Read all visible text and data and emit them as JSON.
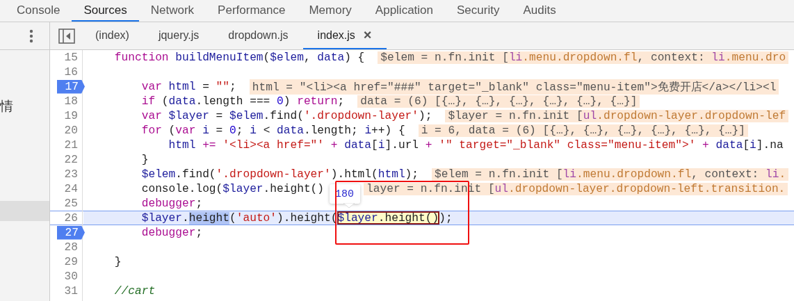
{
  "panel_tabs": [
    {
      "label": "Console",
      "selected": false
    },
    {
      "label": "Sources",
      "selected": true
    },
    {
      "label": "Network",
      "selected": false
    },
    {
      "label": "Performance",
      "selected": false
    },
    {
      "label": "Memory",
      "selected": false
    },
    {
      "label": "Application",
      "selected": false
    },
    {
      "label": "Security",
      "selected": false
    },
    {
      "label": "Audits",
      "selected": false
    }
  ],
  "navigator": {
    "text": "情"
  },
  "file_tabs": [
    {
      "label": "(index)",
      "selected": false
    },
    {
      "label": "jquery.js",
      "selected": false
    },
    {
      "label": "dropdown.js",
      "selected": false
    },
    {
      "label": "index.js",
      "selected": true,
      "close": "×"
    }
  ],
  "lines": [
    {
      "number": "15",
      "breakpoint": false,
      "current": false,
      "tokens": [
        {
          "kind": "keyword",
          "text": "    function"
        },
        {
          "kind": "name",
          "text": " buildMenuItem"
        },
        {
          "kind": "plain",
          "text": "("
        },
        {
          "kind": "name",
          "text": "$elem"
        },
        {
          "kind": "plain",
          "text": ", "
        },
        {
          "kind": "name",
          "text": "data"
        },
        {
          "kind": "plain",
          "text": ") {"
        }
      ],
      "annotation": [
        {
          "kind": "value",
          "text": "$elem = n.fn.init ["
        },
        {
          "kind": "tag",
          "text": "li"
        },
        {
          "kind": "class",
          "text": ".menu.dropdown.fl"
        },
        {
          "kind": "value",
          "text": ", context: "
        },
        {
          "kind": "tag",
          "text": "li"
        },
        {
          "kind": "class",
          "text": ".menu.dro"
        }
      ]
    },
    {
      "number": "16",
      "breakpoint": false,
      "current": false
    },
    {
      "number": "17",
      "breakpoint": true,
      "current": false,
      "tokens": [
        {
          "kind": "keyword",
          "text": "        var"
        },
        {
          "kind": "name",
          "text": " html"
        },
        {
          "kind": "plain",
          "text": " = "
        },
        {
          "kind": "string",
          "text": "\"\""
        },
        {
          "kind": "plain",
          "text": ";"
        }
      ],
      "annotation": [
        {
          "kind": "value",
          "text": "html = \"<li><a href=\"###\" target=\"_blank\" class=\"menu-item\">免费开店</a></li><l"
        }
      ]
    },
    {
      "number": "18",
      "breakpoint": false,
      "current": false,
      "tokens": [
        {
          "kind": "keyword",
          "text": "        if"
        },
        {
          "kind": "plain",
          "text": " ("
        },
        {
          "kind": "name",
          "text": "data"
        },
        {
          "kind": "plain",
          "text": ".length === "
        },
        {
          "kind": "number",
          "text": "0"
        },
        {
          "kind": "plain",
          "text": ") "
        },
        {
          "kind": "keyword",
          "text": "return"
        },
        {
          "kind": "plain",
          "text": ";"
        }
      ],
      "annotation": [
        {
          "kind": "value",
          "text": "data = (6) [{…}, {…}, {…}, {…}, {…}, {…}]"
        }
      ]
    },
    {
      "number": "19",
      "breakpoint": false,
      "current": false,
      "tokens": [
        {
          "kind": "keyword",
          "text": "        var"
        },
        {
          "kind": "name",
          "text": " $layer"
        },
        {
          "kind": "plain",
          "text": " = "
        },
        {
          "kind": "name",
          "text": "$elem"
        },
        {
          "kind": "plain",
          "text": ".find("
        },
        {
          "kind": "string",
          "text": "'.dropdown-layer'"
        },
        {
          "kind": "plain",
          "text": ");"
        }
      ],
      "annotation": [
        {
          "kind": "value",
          "text": "$layer = n.fn.init ["
        },
        {
          "kind": "tag",
          "text": "ul"
        },
        {
          "kind": "class",
          "text": ".dropdown-layer.dropdown-lef"
        }
      ]
    },
    {
      "number": "20",
      "breakpoint": false,
      "current": false,
      "tokens": [
        {
          "kind": "keyword",
          "text": "        for"
        },
        {
          "kind": "plain",
          "text": " ("
        },
        {
          "kind": "keyword",
          "text": "var"
        },
        {
          "kind": "name",
          "text": " i"
        },
        {
          "kind": "plain",
          "text": " = "
        },
        {
          "kind": "number",
          "text": "0"
        },
        {
          "kind": "plain",
          "text": "; "
        },
        {
          "kind": "name",
          "text": "i"
        },
        {
          "kind": "plain",
          "text": " < "
        },
        {
          "kind": "name",
          "text": "data"
        },
        {
          "kind": "plain",
          "text": ".length; "
        },
        {
          "kind": "name",
          "text": "i"
        },
        {
          "kind": "plain",
          "text": "++) {"
        }
      ],
      "annotation": [
        {
          "kind": "value",
          "text": "i = 6, data = (6) [{…}, {…}, {…}, {…}, {…}, {…}]"
        }
      ]
    },
    {
      "number": "21",
      "breakpoint": false,
      "current": false,
      "tokens": [
        {
          "kind": "name",
          "text": "            html"
        },
        {
          "kind": "operator",
          "text": " +="
        },
        {
          "kind": "string",
          "text": " '<li><a href=\"'"
        },
        {
          "kind": "operator",
          "text": " +"
        },
        {
          "kind": "name",
          "text": " data"
        },
        {
          "kind": "plain",
          "text": "["
        },
        {
          "kind": "name",
          "text": "i"
        },
        {
          "kind": "plain",
          "text": "].url "
        },
        {
          "kind": "operator",
          "text": "+"
        },
        {
          "kind": "string",
          "text": " '\" target=\"_blank\" class=\"menu-item\">'"
        },
        {
          "kind": "operator",
          "text": " +"
        },
        {
          "kind": "name",
          "text": " data"
        },
        {
          "kind": "plain",
          "text": "["
        },
        {
          "kind": "name",
          "text": "i"
        },
        {
          "kind": "plain",
          "text": "].na"
        }
      ]
    },
    {
      "number": "22",
      "breakpoint": false,
      "current": false,
      "tokens": [
        {
          "kind": "plain",
          "text": "        }"
        }
      ]
    },
    {
      "number": "23",
      "breakpoint": false,
      "current": false,
      "tokens": [
        {
          "kind": "name",
          "text": "        $elem"
        },
        {
          "kind": "plain",
          "text": ".find("
        },
        {
          "kind": "string",
          "text": "'.dropdown-layer'"
        },
        {
          "kind": "plain",
          "text": ").html("
        },
        {
          "kind": "name",
          "text": "html"
        },
        {
          "kind": "plain",
          "text": ");"
        }
      ],
      "annotation": [
        {
          "kind": "value",
          "text": "$elem = n.fn.init ["
        },
        {
          "kind": "tag",
          "text": "li"
        },
        {
          "kind": "class",
          "text": ".menu.dropdown.fl"
        },
        {
          "kind": "value",
          "text": ", context: "
        },
        {
          "kind": "tag",
          "text": "li"
        },
        {
          "kind": "class",
          "text": "."
        }
      ]
    },
    {
      "number": "24",
      "breakpoint": false,
      "current": false,
      "tokens": [
        {
          "kind": "plain",
          "text": "        console.log("
        },
        {
          "kind": "name",
          "text": "$layer"
        },
        {
          "kind": "plain",
          "text": ".height()"
        }
      ],
      "annotation": [
        {
          "kind": "value",
          "text": "layer = n.fn.init ["
        },
        {
          "kind": "tag",
          "text": "ul"
        },
        {
          "kind": "class",
          "text": ".dropdown-layer.dropdown-left.transition."
        }
      ]
    },
    {
      "number": "25",
      "breakpoint": false,
      "current": false,
      "tokens": [
        {
          "kind": "keyword",
          "text": "        debugger"
        },
        {
          "kind": "plain",
          "text": ";"
        }
      ]
    },
    {
      "number": "26",
      "breakpoint": false,
      "current": true,
      "tokens": [
        {
          "kind": "name",
          "text": "        $layer"
        },
        {
          "kind": "plain",
          "text": "."
        },
        {
          "kind": "selection",
          "text": "height"
        },
        {
          "kind": "plain",
          "text": "("
        },
        {
          "kind": "string",
          "text": "'auto'"
        },
        {
          "kind": "plain",
          "text": ").height("
        },
        {
          "kind": "hover",
          "popover": "180",
          "tokens": [
            {
              "kind": "name",
              "text": "$layer"
            },
            {
              "kind": "plain",
              "text": ".height()"
            }
          ]
        },
        {
          "kind": "plain",
          "text": ");"
        }
      ]
    },
    {
      "number": "27",
      "breakpoint": true,
      "current": false,
      "tokens": [
        {
          "kind": "keyword",
          "text": "        debugger"
        },
        {
          "kind": "plain",
          "text": ";"
        }
      ]
    },
    {
      "number": "28",
      "breakpoint": false,
      "current": false
    },
    {
      "number": "29",
      "breakpoint": false,
      "current": false,
      "tokens": [
        {
          "kind": "plain",
          "text": "    }"
        }
      ]
    },
    {
      "number": "30",
      "breakpoint": false,
      "current": false
    },
    {
      "number": "31",
      "breakpoint": false,
      "current": false,
      "tokens": [
        {
          "kind": "comment",
          "text": "    //cart"
        }
      ]
    }
  ]
}
